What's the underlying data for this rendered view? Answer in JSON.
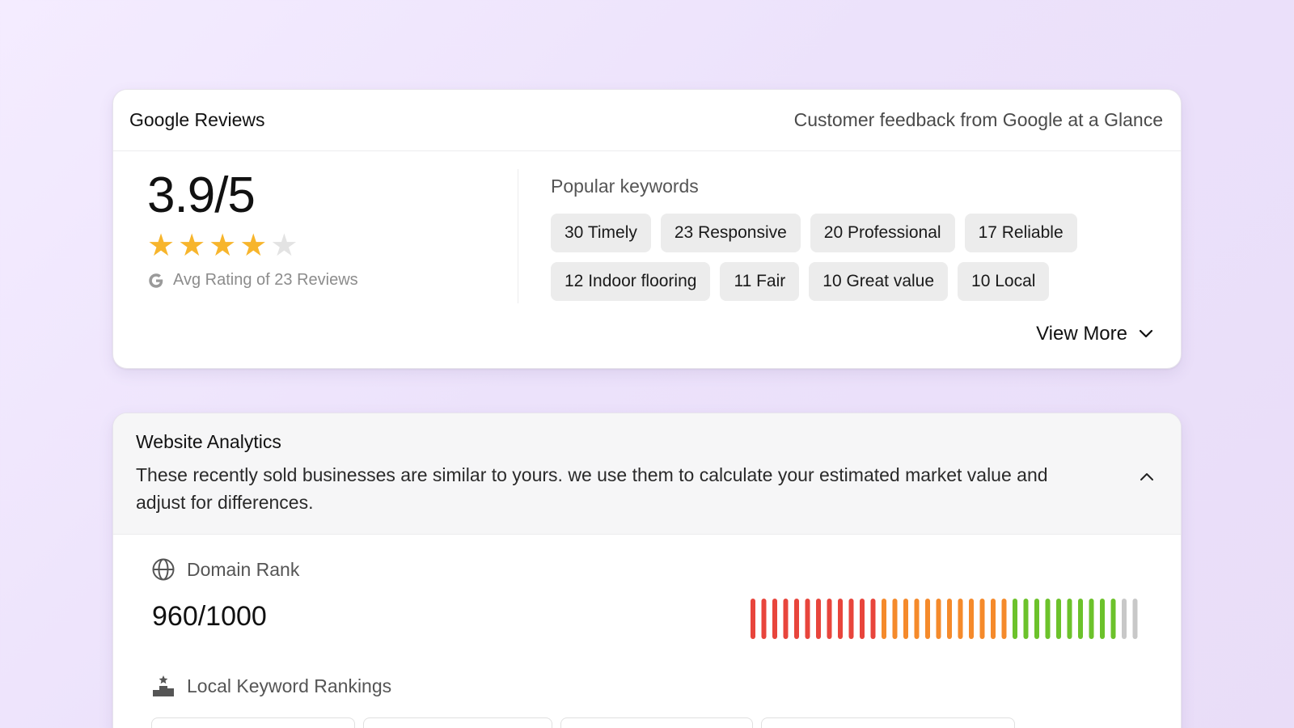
{
  "reviews": {
    "title": "Google Reviews",
    "subtitle": "Customer feedback from Google at a Glance",
    "score": "3.9/5",
    "rating": 3.9,
    "stars_filled": 4,
    "stars_total": 5,
    "caption": "Avg Rating of 23 Reviews",
    "keywords_title": "Popular keywords",
    "keywords": [
      "30 Timely",
      "23 Responsive",
      "20 Professional",
      "17 Reliable",
      "12 Indoor flooring",
      "11 Fair",
      "10 Great value",
      "10 Local"
    ],
    "view_more_label": "View More",
    "star_color": "#f7b52c"
  },
  "analytics": {
    "title": "Website Analytics",
    "description": "These recently sold businesses are similar to yours. we use them to calculate your estimated market value and adjust for differences.",
    "domain_rank_label": "Domain Rank",
    "domain_rank_value": "960/1000",
    "domain_rank": 960,
    "domain_rank_max": 1000,
    "local_keyword_label": "Local Keyword Rankings",
    "gauge_colors": {
      "low": "#e8453c",
      "mid": "#f58a2b",
      "high": "#6cc22b",
      "empty": "#c8c8c8"
    }
  }
}
